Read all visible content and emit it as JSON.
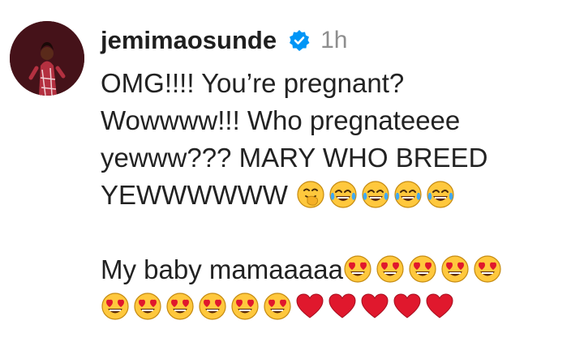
{
  "comment": {
    "username": "jemimaosunde",
    "timestamp": "1h",
    "lines": [
      "OMG!!!! You’re pregnant?",
      "Wowwww!!! Who pregnateeee",
      "yewww??? MARY WHO BREED",
      "YEWWWWWW",
      "",
      "My baby mamaaaaa"
    ],
    "emojis": {
      "line4": [
        "face-with-hand-over-mouth",
        "face-with-tears-of-joy",
        "face-with-tears-of-joy",
        "face-with-tears-of-joy",
        "face-with-tears-of-joy"
      ],
      "line6": [
        "heart-eyes",
        "heart-eyes",
        "heart-eyes",
        "heart-eyes",
        "heart-eyes"
      ],
      "line7": [
        "heart-eyes",
        "heart-eyes",
        "heart-eyes",
        "heart-eyes",
        "heart-eyes",
        "heart-eyes",
        "red-heart",
        "red-heart",
        "red-heart",
        "red-heart",
        "red-heart"
      ]
    }
  },
  "colors": {
    "text": "#222222",
    "timestamp": "#8e8e8e",
    "verified_badge": "#0095f6",
    "emoji_face": "#ffc83d",
    "heart": "#e0182d"
  }
}
